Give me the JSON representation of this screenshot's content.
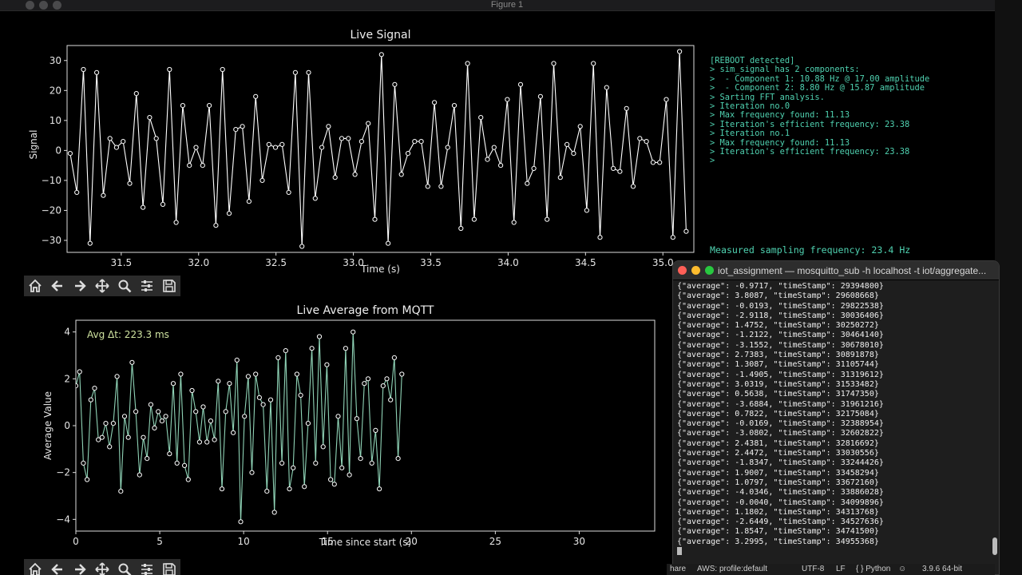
{
  "window": {
    "title": "Figure 1"
  },
  "toolbar": {
    "icons": [
      "home-icon",
      "back-arrow-icon",
      "forward-arrow-icon",
      "pan-icon",
      "zoom-icon",
      "configure-icon",
      "save-icon"
    ]
  },
  "chart_data": [
    {
      "type": "line",
      "title": "Live Signal",
      "xlabel": "Time (s)",
      "ylabel": "Signal",
      "xlim": [
        31.15,
        35.2
      ],
      "ylim": [
        -34,
        35
      ],
      "xticks": [
        31.5,
        32.0,
        32.5,
        33.0,
        33.5,
        34.0,
        34.5,
        35.0
      ],
      "xtick_labels": [
        "31.5",
        "32.0",
        "32.5",
        "33.0",
        "33.5",
        "34.0",
        "34.5",
        "35.0"
      ],
      "yticks": [
        -30,
        -20,
        -10,
        0,
        10,
        20,
        30
      ],
      "ytick_labels": [
        "−30",
        "−20",
        "−10",
        "0",
        "10",
        "20",
        "30"
      ],
      "line_color": "#ffffff",
      "series": [
        {
          "x_start": 31.17,
          "x_step": 0.0428,
          "values": [
            -1,
            -14,
            27,
            -31,
            26,
            -15,
            4,
            1,
            3,
            -11,
            19,
            -19,
            11,
            4,
            -18,
            27,
            -24,
            15,
            -5,
            1,
            -5,
            15,
            -25,
            27,
            -21,
            7,
            8,
            -17,
            18,
            -10,
            2,
            1,
            2,
            -14,
            26,
            -32,
            26,
            -16,
            1,
            8,
            -9,
            4,
            4,
            -8,
            3,
            9,
            -23,
            32,
            -31,
            22,
            -8,
            -1,
            3,
            3,
            -12,
            16,
            -12,
            1,
            15,
            -26,
            29,
            -23,
            11,
            -3,
            1,
            -5,
            17,
            -24,
            22,
            -11,
            -6,
            18,
            -23,
            29,
            -9,
            2,
            -1,
            8,
            -20,
            29,
            -29,
            21,
            -6,
            -7,
            14,
            -12,
            4,
            3,
            -4,
            -4,
            17,
            -29,
            33,
            -27
          ]
        }
      ]
    },
    {
      "type": "line",
      "title": "Live Average from MQTT",
      "xlabel": "Time since start (s)",
      "ylabel": "Average Value",
      "xlim": [
        0,
        34.5
      ],
      "ylim": [
        -4.5,
        4.5
      ],
      "xticks": [
        0,
        5,
        10,
        15,
        20,
        25,
        30
      ],
      "xtick_labels": [
        "0",
        "5",
        "10",
        "15",
        "20",
        "25",
        "30"
      ],
      "yticks": [
        -4,
        -2,
        0,
        2,
        4
      ],
      "ytick_labels": [
        "−4",
        "−2",
        "0",
        "2",
        "4"
      ],
      "annotation": "Avg Δt: 223.3 ms",
      "line_color": "#8fd3b6",
      "series": [
        {
          "x_start": 0,
          "x_step": 0.2233,
          "values": [
            1.7,
            2.3,
            -1.6,
            -2.3,
            1.1,
            1.6,
            -0.6,
            -0.5,
            0.1,
            -0.9,
            0.1,
            2.1,
            -2.8,
            0.4,
            -0.5,
            2.7,
            0.6,
            -2.1,
            -0.5,
            -1.4,
            0.9,
            -0.1,
            0.6,
            0.2,
            0.4,
            -1.2,
            1.8,
            -1.6,
            2.2,
            -1.7,
            -2.3,
            1.5,
            0.6,
            -0.7,
            0.8,
            -0.7,
            0.2,
            -0.6,
            1.9,
            -2.7,
            0.6,
            1.8,
            -0.3,
            2.8,
            -4.1,
            0.4,
            2.1,
            -2.0,
            2.2,
            1.2,
            0.9,
            -2.8,
            1.1,
            -3.7,
            2.9,
            -1.6,
            3.2,
            -2.7,
            -1.8,
            2.2,
            1.3,
            -2.6,
            0.1,
            3.3,
            -1.6,
            3.8,
            -0.9,
            2.6,
            -2.3,
            -2.5,
            0.4,
            -1.8,
            3.3,
            -2.1,
            4.0,
            0.3,
            -1.4,
            1.8,
            2.0,
            -1.6,
            -0.2,
            -2.7,
            1.7,
            2.0,
            1.1,
            2.9,
            -1.4,
            2.2
          ]
        }
      ]
    }
  ],
  "console": {
    "lines": [
      "[REBOOT detected]",
      "> sim_signal has 2 components:",
      ">  - Component 1: 10.88 Hz @ 17.00 amplitude",
      ">  - Component 2: 8.80 Hz @ 15.87 amplitude",
      "> Sarting FFT analysis.",
      "> Iteration no.0",
      "> Max frequency found: 11.13",
      "> Iteration's efficient frequency: 23.38",
      "> Iteration no.1",
      "> Max frequency found: 11.13",
      "> Iteration's efficient frequency: 23.38",
      ">"
    ],
    "sampling": "Measured sampling frequency: 23.4 Hz"
  },
  "terminal": {
    "title": "iot_assignment — mosquitto_sub -h localhost -t iot/aggregate...",
    "lines": [
      "{\"average\": -0.9717, \"timeStamp\": 29394800}",
      "{\"average\": 3.8087, \"timeStamp\": 29608668}",
      "{\"average\": -0.0193, \"timeStamp\": 29822538}",
      "{\"average\": -2.9118, \"timeStamp\": 30036406}",
      "{\"average\": 1.4752, \"timeStamp\": 30250272}",
      "{\"average\": -1.2122, \"timeStamp\": 30464140}",
      "{\"average\": -3.1552, \"timeStamp\": 30678010}",
      "{\"average\": 2.7383, \"timeStamp\": 30891878}",
      "{\"average\": 1.3087, \"timeStamp\": 31105744}",
      "{\"average\": -1.4905, \"timeStamp\": 31319612}",
      "{\"average\": 3.0319, \"timeStamp\": 31533482}",
      "{\"average\": 0.5638, \"timeStamp\": 31747350}",
      "{\"average\": -3.6884, \"timeStamp\": 31961216}",
      "{\"average\": 0.7822, \"timeStamp\": 32175084}",
      "{\"average\": -0.0169, \"timeStamp\": 32388954}",
      "{\"average\": -3.0802, \"timeStamp\": 32602822}",
      "{\"average\": 2.4381, \"timeStamp\": 32816692}",
      "{\"average\": 2.4472, \"timeStamp\": 33030556}",
      "{\"average\": -1.8347, \"timeStamp\": 33244426}",
      "{\"average\": 1.9007, \"timeStamp\": 33458294}",
      "{\"average\": 1.0797, \"timeStamp\": 33672160}",
      "{\"average\": -4.0346, \"timeStamp\": 33886028}",
      "{\"average\": -0.0040, \"timeStamp\": 34099896}",
      "{\"average\": 1.1802, \"timeStamp\": 34313768}",
      "{\"average\": -2.6449, \"timeStamp\": 34527636}",
      "{\"average\": 1.8547, \"timeStamp\": 34741500}",
      "{\"average\": 3.2995, \"timeStamp\": 34955368}"
    ]
  },
  "statusbar": {
    "share": "hare",
    "aws": "AWS: profile:default",
    "encoding": "UTF-8",
    "eol": "LF",
    "language": "{ } Python",
    "interpreter": "3.9.6 64-bit"
  }
}
